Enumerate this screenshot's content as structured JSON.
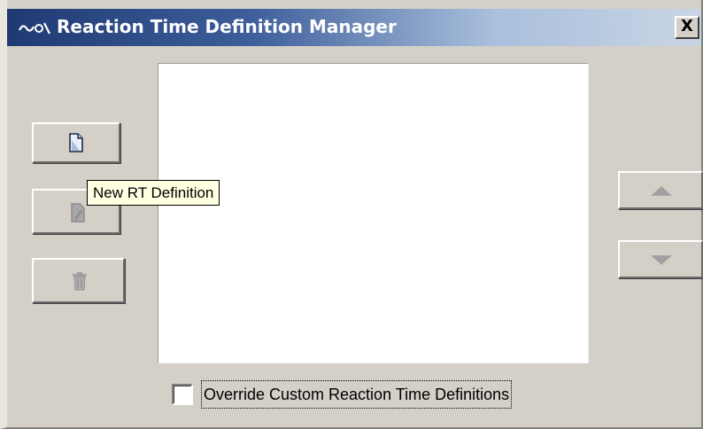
{
  "window": {
    "title": "Reaction Time Definition Manager",
    "title_icon": "wave-signal-icon",
    "close_label": "X"
  },
  "toolbar": {
    "new_icon": "new-document-icon",
    "edit_icon": "edit-document-icon",
    "delete_icon": "trash-icon"
  },
  "tooltip": {
    "text": "New RT Definition"
  },
  "list": {
    "items": []
  },
  "reorder": {
    "up_icon": "arrow-up-icon",
    "down_icon": "arrow-down-icon"
  },
  "override": {
    "label": "Override Custom Reaction Time Definitions",
    "checked": false
  },
  "colors": {
    "title_gradient_start": "#1f3a73",
    "title_gradient_end": "#c9d5e4",
    "face": "#d4d0c8",
    "tooltip_bg": "#ffffe1"
  }
}
